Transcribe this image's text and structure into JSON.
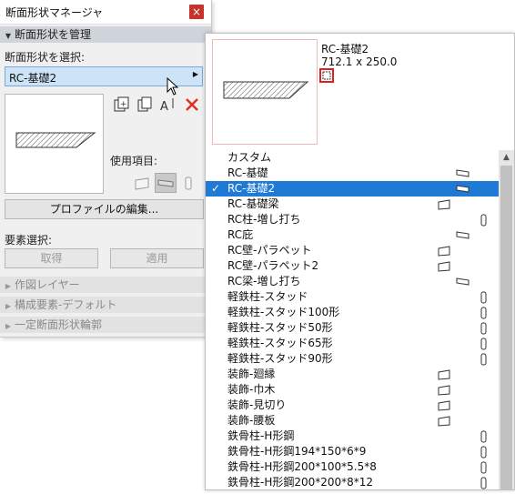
{
  "palette": {
    "title": "断面形状マネージャ",
    "close_symbol": "×",
    "manage_header": "断面形状を管理",
    "select_label": "断面形状を選択:",
    "selected_profile": "RC-基礎2",
    "usage_label": "使用項目:",
    "edit_button": "プロファイルの編集...",
    "element_select_label": "要素選択:",
    "get_button": "取得",
    "apply_button": "適用",
    "collapsed_sections": [
      "作図レイヤー",
      "構成要素-デフォルト",
      "一定断面形状輪郭"
    ]
  },
  "popup": {
    "name": "RC-基礎2",
    "dimensions": "712.1 x 250.0",
    "items": [
      {
        "label": "カスタム",
        "icon": ""
      },
      {
        "label": "RC-基礎",
        "icon": "slab-icon"
      },
      {
        "label": "RC-基礎2",
        "icon": "slab-icon",
        "selected": true
      },
      {
        "label": "RC-基礎梁",
        "icon": "wall-icon"
      },
      {
        "label": "RC柱-増し打ち",
        "icon": "column-icon"
      },
      {
        "label": "RC庇",
        "icon": "slab-icon"
      },
      {
        "label": "RC壁-パラペット",
        "icon": "wall-icon"
      },
      {
        "label": "RC壁-パラペット2",
        "icon": "wall-icon"
      },
      {
        "label": "RC梁-増し打ち",
        "icon": "slab-icon"
      },
      {
        "label": "軽鉄柱-スタッド",
        "icon": "column-icon"
      },
      {
        "label": "軽鉄柱-スタッド100形",
        "icon": "column-icon"
      },
      {
        "label": "軽鉄柱-スタッド50形",
        "icon": "column-icon"
      },
      {
        "label": "軽鉄柱-スタッド65形",
        "icon": "column-icon"
      },
      {
        "label": "軽鉄柱-スタッド90形",
        "icon": "column-icon"
      },
      {
        "label": "装飾-廻縁",
        "icon": "wall-icon"
      },
      {
        "label": "装飾-巾木",
        "icon": "wall-icon"
      },
      {
        "label": "装飾-見切り",
        "icon": "wall-icon"
      },
      {
        "label": "装飾-腰板",
        "icon": "wall-icon"
      },
      {
        "label": "鉄骨柱-H形鋼",
        "icon": "column-icon"
      },
      {
        "label": "鉄骨柱-H形鋼194*150*6*9",
        "icon": "column-icon"
      },
      {
        "label": "鉄骨柱-H形鋼200*100*5.5*8",
        "icon": "column-icon"
      },
      {
        "label": "鉄骨柱-H形鋼200*200*8*12",
        "icon": "column-icon"
      }
    ]
  },
  "colors": {
    "selection": "#1f7ad6",
    "select_box": "#cde3f7",
    "delete_icon": "#e03020",
    "close_button": "#c9312b"
  }
}
